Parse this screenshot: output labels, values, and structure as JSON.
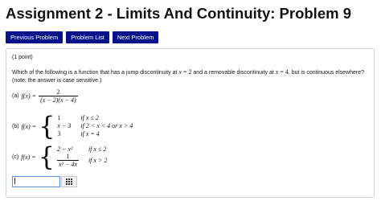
{
  "page": {
    "title": "Assignment 2 - Limits And Continuity: Problem 9"
  },
  "nav": {
    "previous": "Previous Problem",
    "list": "Problem List",
    "next": "Next Problem"
  },
  "problem": {
    "points": "(1 point)",
    "q_part1": "Which of the following is a function that has a jump discontinuity at ",
    "q_x1": "x",
    "q_eq1": " = 2",
    "q_part2": " and a removable discontinuity at ",
    "q_x2": "x",
    "q_eq2": " = 4",
    "q_part3": ", but is continuous elsewhere? (note: the answer is case sensitive.)",
    "a": {
      "label": "(a)",
      "lhs": "f(x) =",
      "num": "2",
      "den": "(x − 2)(x − 4)"
    },
    "b": {
      "label": "(b)",
      "lhs": "f(x) =",
      "rows": [
        {
          "expr": "1",
          "cond": "if x ≤ 2"
        },
        {
          "expr": "x − 3",
          "cond": "if 2 < x < 4 or x > 4"
        },
        {
          "expr": "3",
          "cond": "if x = 4"
        }
      ]
    },
    "c": {
      "label": "(c)",
      "lhs": "f(x) =",
      "row1_expr": "2 − x²",
      "row1_cond": "if x ≤ 2",
      "row2_num": "1",
      "row2_den": "x² − 4x",
      "row2_cond": "if x > 2"
    },
    "answer_value": ""
  },
  "icons": {
    "keypad": "grid-icon"
  },
  "colors": {
    "nav_button_bg": "#06128a",
    "input_border": "#5b8fd8"
  }
}
